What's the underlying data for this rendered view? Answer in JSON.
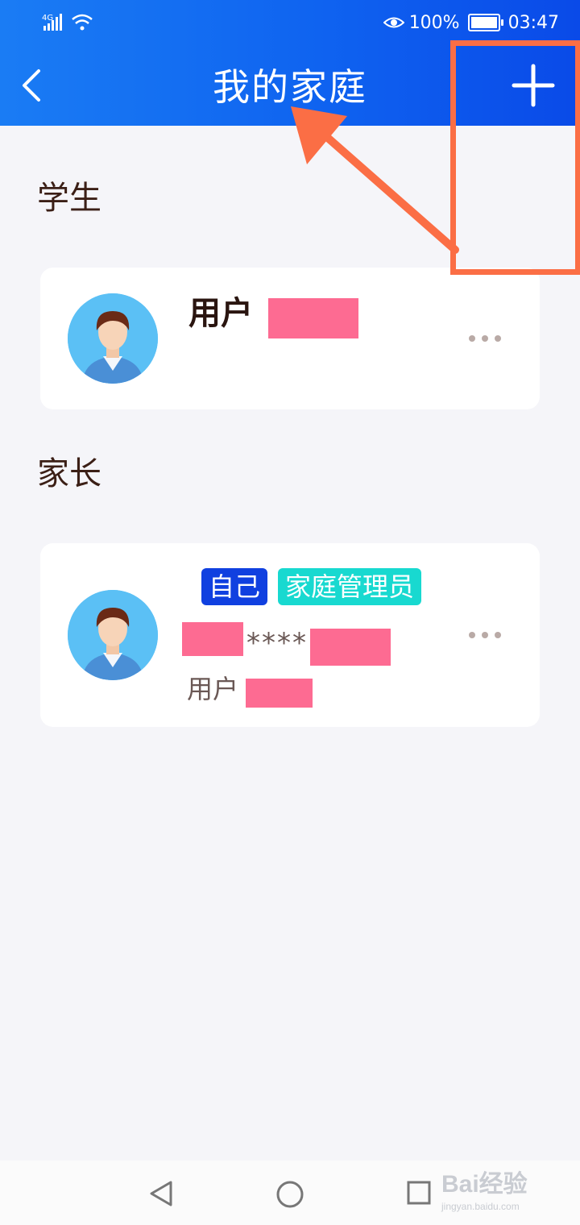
{
  "status_bar": {
    "network": "4G",
    "battery_percent": "100%",
    "time": "03:47"
  },
  "header": {
    "title": "我的家庭",
    "back_icon": "chevron-left-icon",
    "add_icon": "plus-icon"
  },
  "sections": {
    "student": {
      "label": "学生",
      "member": {
        "name": "用户",
        "more_icon": "more-horizontal-icon"
      }
    },
    "parent": {
      "label": "家长",
      "member": {
        "tags": [
          "自己",
          "家庭管理员"
        ],
        "phone_masked": "****",
        "name": "用户",
        "more_icon": "more-horizontal-icon"
      }
    }
  },
  "watermark": {
    "logo": "Bai经验",
    "url": "jingyan.baidu.com"
  },
  "colors": {
    "header_blue": "#0f63f0",
    "annotation_orange": "#fb6e45",
    "redaction_pink": "#fd6b92",
    "tag_self": "#1040e0",
    "tag_admin": "#18d9d0"
  }
}
